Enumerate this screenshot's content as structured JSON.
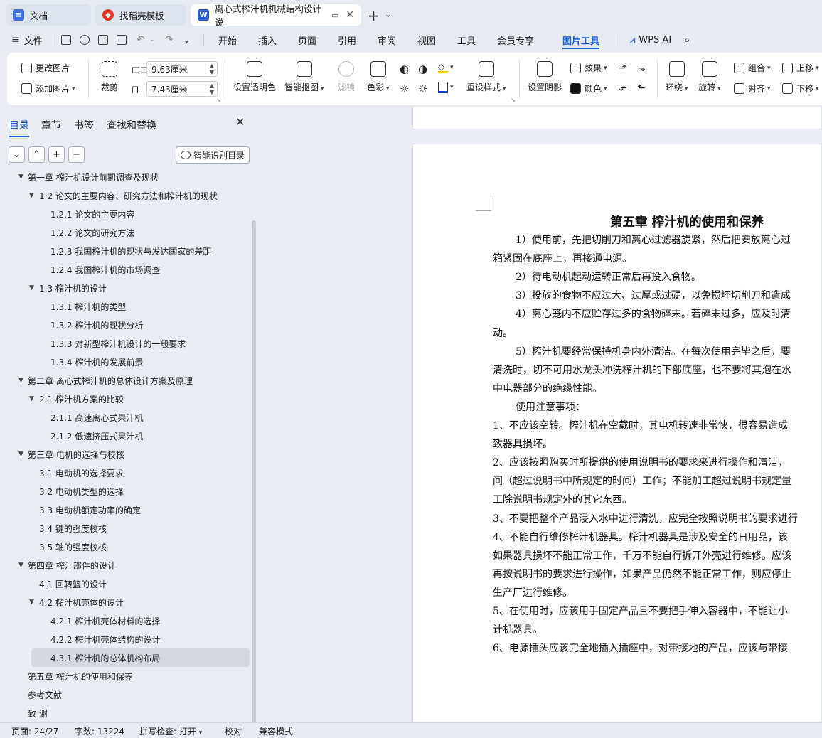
{
  "tabs": [
    {
      "label": "文档",
      "icon": "doc-icon",
      "color": "#3b6fe0"
    },
    {
      "label": "找稻壳模板",
      "icon": "docer-icon",
      "color": "#e2352c"
    },
    {
      "label": "离心式榨汁机机械结构设计 说",
      "icon": "word-icon",
      "color": "#2a5bd7"
    }
  ],
  "menu": {
    "file": "文件",
    "items": [
      "开始",
      "插入",
      "页面",
      "引用",
      "审阅",
      "视图",
      "工具",
      "会员专享",
      "图片工具"
    ],
    "active": "图片工具",
    "wps_ai": "WPS AI"
  },
  "ribbon": {
    "change_image": "更改图片",
    "add_image": "添加图片",
    "crop": "裁剪",
    "width": "9.63厘米",
    "height": "7.43厘米",
    "set_transparent": "设置透明色",
    "smart_cutout": "智能抠图",
    "filter": "滤镜",
    "color_tone": "色彩",
    "reset_style": "重设样式",
    "set_shadow": "设置阴影",
    "effect": "效果",
    "color": "颜色",
    "wrap": "环绕",
    "rotate": "旋转",
    "group": "组合",
    "align": "对齐",
    "move_up": "上移",
    "move_down": "下移"
  },
  "nav": {
    "tabs": [
      "目录",
      "章节",
      "书签",
      "查找和替换"
    ],
    "active_tab": "目录",
    "smart_toc": "智能识别目录",
    "toc": [
      {
        "label": "第一章 榨汁机设计前期调查及现状",
        "level": 1,
        "toggle": "▼"
      },
      {
        "label": "1.2 论文的主要内容、研究方法和榨汁机的现状",
        "level": 2,
        "toggle": "▼"
      },
      {
        "label": "1.2.1 论文的主要内容",
        "level": 3,
        "toggle": ""
      },
      {
        "label": "1.2.2 论文的研究方法",
        "level": 3,
        "toggle": ""
      },
      {
        "label": "1.2.3 我国榨汁机的现状与发达国家的差距",
        "level": 3,
        "toggle": ""
      },
      {
        "label": "1.2.4 我国榨汁机的市场调查",
        "level": 3,
        "toggle": ""
      },
      {
        "label": "1.3  榨汁机的设计",
        "level": 2,
        "toggle": "▼"
      },
      {
        "label": "1.3.1 榨汁机的类型",
        "level": 3,
        "toggle": ""
      },
      {
        "label": "1.3.2  榨汁机的现状分析",
        "level": 3,
        "toggle": ""
      },
      {
        "label": "1.3.3 对新型榨汁机设计的一般要求",
        "level": 3,
        "toggle": ""
      },
      {
        "label": "1.3.4  榨汁机的发展前景",
        "level": 3,
        "toggle": ""
      },
      {
        "label": "第二章  离心式榨汁机的总体设计方案及原理",
        "level": 1,
        "toggle": "▼"
      },
      {
        "label": "2.1  榨汁机方案的比较",
        "level": 2,
        "toggle": "▼"
      },
      {
        "label": "2.1.1 高速离心式果汁机",
        "level": 3,
        "toggle": ""
      },
      {
        "label": "2.1.2  低速挤压式果汁机",
        "level": 3,
        "toggle": ""
      },
      {
        "label": "第三章  电机的选择与校核",
        "level": 1,
        "toggle": "▼"
      },
      {
        "label": "3.1  电动机的选择要求",
        "level": 2,
        "toggle": ""
      },
      {
        "label": "3.2  电动机类型的选择",
        "level": 2,
        "toggle": ""
      },
      {
        "label": "3.3  电动机额定功率的确定",
        "level": 2,
        "toggle": ""
      },
      {
        "label": "3.4  键的强度校核",
        "level": 2,
        "toggle": ""
      },
      {
        "label": "3.5  轴的强度校核",
        "level": 2,
        "toggle": ""
      },
      {
        "label": "第四章     榨汁部件的设计",
        "level": 1,
        "toggle": "▼"
      },
      {
        "label": "4.1  回转篮的设计",
        "level": 2,
        "toggle": ""
      },
      {
        "label": "4.2 榨汁机壳体的设计",
        "level": 2,
        "toggle": "▼"
      },
      {
        "label": "4.2.1  榨汁机壳体材料的选择",
        "level": 3,
        "toggle": ""
      },
      {
        "label": "4.2.2 榨汁机壳体结构的设计",
        "level": 3,
        "toggle": ""
      },
      {
        "label": "4.3.1 榨汁机的总体机构布局",
        "level": 3,
        "toggle": "",
        "selected": true
      },
      {
        "label": "第五章   榨汁机的使用和保养",
        "level": 1,
        "toggle": ""
      },
      {
        "label": "参考文献",
        "level": 1,
        "toggle": ""
      },
      {
        "label": "致      谢",
        "level": 1,
        "toggle": ""
      }
    ]
  },
  "document": {
    "title": "第五章    榨汁机的使用和保养",
    "lines": [
      {
        "text": "1）使用前，先把切削刀和离心过滤器旋紧，然后把安放离心过",
        "indent": true
      },
      {
        "text": "箱紧固在底座上，再接通电源。",
        "indent": false
      },
      {
        "text": "2）待电动机起动运转正常后再投入食物。",
        "indent": true
      },
      {
        "text": "3）投放的食物不应过大、过厚或过硬，以免损坏切削刀和造成",
        "indent": true
      },
      {
        "text": "4）离心笼内不应贮存过多的食物碎末。若碎末过多，应及时清",
        "indent": true
      },
      {
        "text": "动。",
        "indent": false
      },
      {
        "text": "5）榨汁机要经常保持机身内外清洁。在每次使用完毕之后，要",
        "indent": true
      },
      {
        "text": "清洗时，切不可用水龙头冲洗榨汁机的下部底座，也不要将其泡在水",
        "indent": false
      },
      {
        "text": "中电器部分的绝缘性能。",
        "indent": false
      },
      {
        "text": "使用注意事项：",
        "indent": true
      },
      {
        "text": "1、不应该空转。榨汁机在空载时，其电机转速非常快，很容易造成",
        "indent": false
      },
      {
        "text": "致器具损坏。",
        "indent": false
      },
      {
        "text": "2、应该按照购买时所提供的使用说明书的要求来进行操作和清洁，",
        "indent": false
      },
      {
        "text": "间（超过说明书中所规定的时间）工作；不能加工超过说明书规定量",
        "indent": false
      },
      {
        "text": "工除说明书规定外的其它东西。",
        "indent": false
      },
      {
        "text": "3、不要把整个产品浸入水中进行清洗，应完全按照说明书的要求进行",
        "indent": false
      },
      {
        "text": "4、不能自行维修榨汁机器具。榨汁机器具是涉及安全的日用品，该",
        "indent": false
      },
      {
        "text": "如果器具损坏不能正常工作，千万不能自行拆开外壳进行维修。应该",
        "indent": false
      },
      {
        "text": "再按说明书的要求进行操作，如果产品仍然不能正常工作，则应停止",
        "indent": false
      },
      {
        "text": "生产厂进行维修。",
        "indent": false
      },
      {
        "text": "5、在使用时，应该用手固定产品且不要把手伸入容器中，不能让小",
        "indent": false
      },
      {
        "text": "计机器具。",
        "indent": false
      },
      {
        "text": "6、电源插头应该完全地插入插座中，对带接地的产品，应该与带接",
        "indent": false
      }
    ]
  },
  "status": {
    "page": "页面: 24/27",
    "words": "字数: 13224",
    "spell": "拼写检查: 打开",
    "proof": "校对",
    "compat": "兼容模式"
  }
}
